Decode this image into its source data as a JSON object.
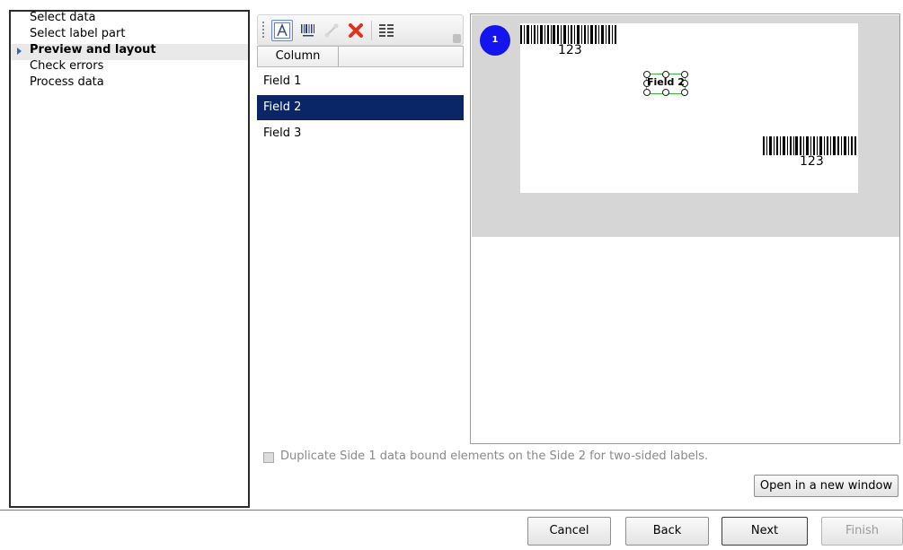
{
  "wizard": {
    "steps": [
      {
        "label": "Select data"
      },
      {
        "label": "Select label part"
      },
      {
        "label": "Preview and layout"
      },
      {
        "label": "Check errors"
      },
      {
        "label": "Process data"
      }
    ],
    "active_step_index": 2
  },
  "toolbar": {
    "icons": [
      "text-tool-icon",
      "barcode-tool-icon",
      "link-icon",
      "delete-icon",
      "columns-icon"
    ],
    "selected_icon": "text-tool-icon"
  },
  "column_list": {
    "header": "Column",
    "fields": [
      {
        "label": "Field 1"
      },
      {
        "label": "Field 2"
      },
      {
        "label": "Field 3"
      }
    ],
    "selected_index": 1
  },
  "preview": {
    "side_badge": "1",
    "barcode_top_text": "123",
    "field_element_text": "Field 2",
    "barcode_bottom_text": "123"
  },
  "options": {
    "duplicate_label": "Duplicate Side 1 data bound elements on the Side 2 for two-sided labels.",
    "duplicate_checked": false
  },
  "buttons": {
    "open_window": "Open in a new window",
    "cancel": "Cancel",
    "back": "Back",
    "next": "Next",
    "finish": "Finish"
  },
  "colors": {
    "selection": "#0a2666",
    "side_badge": "#1414ef",
    "handle_line": "#3bb23b",
    "step_arrow": "#2f67b5"
  }
}
